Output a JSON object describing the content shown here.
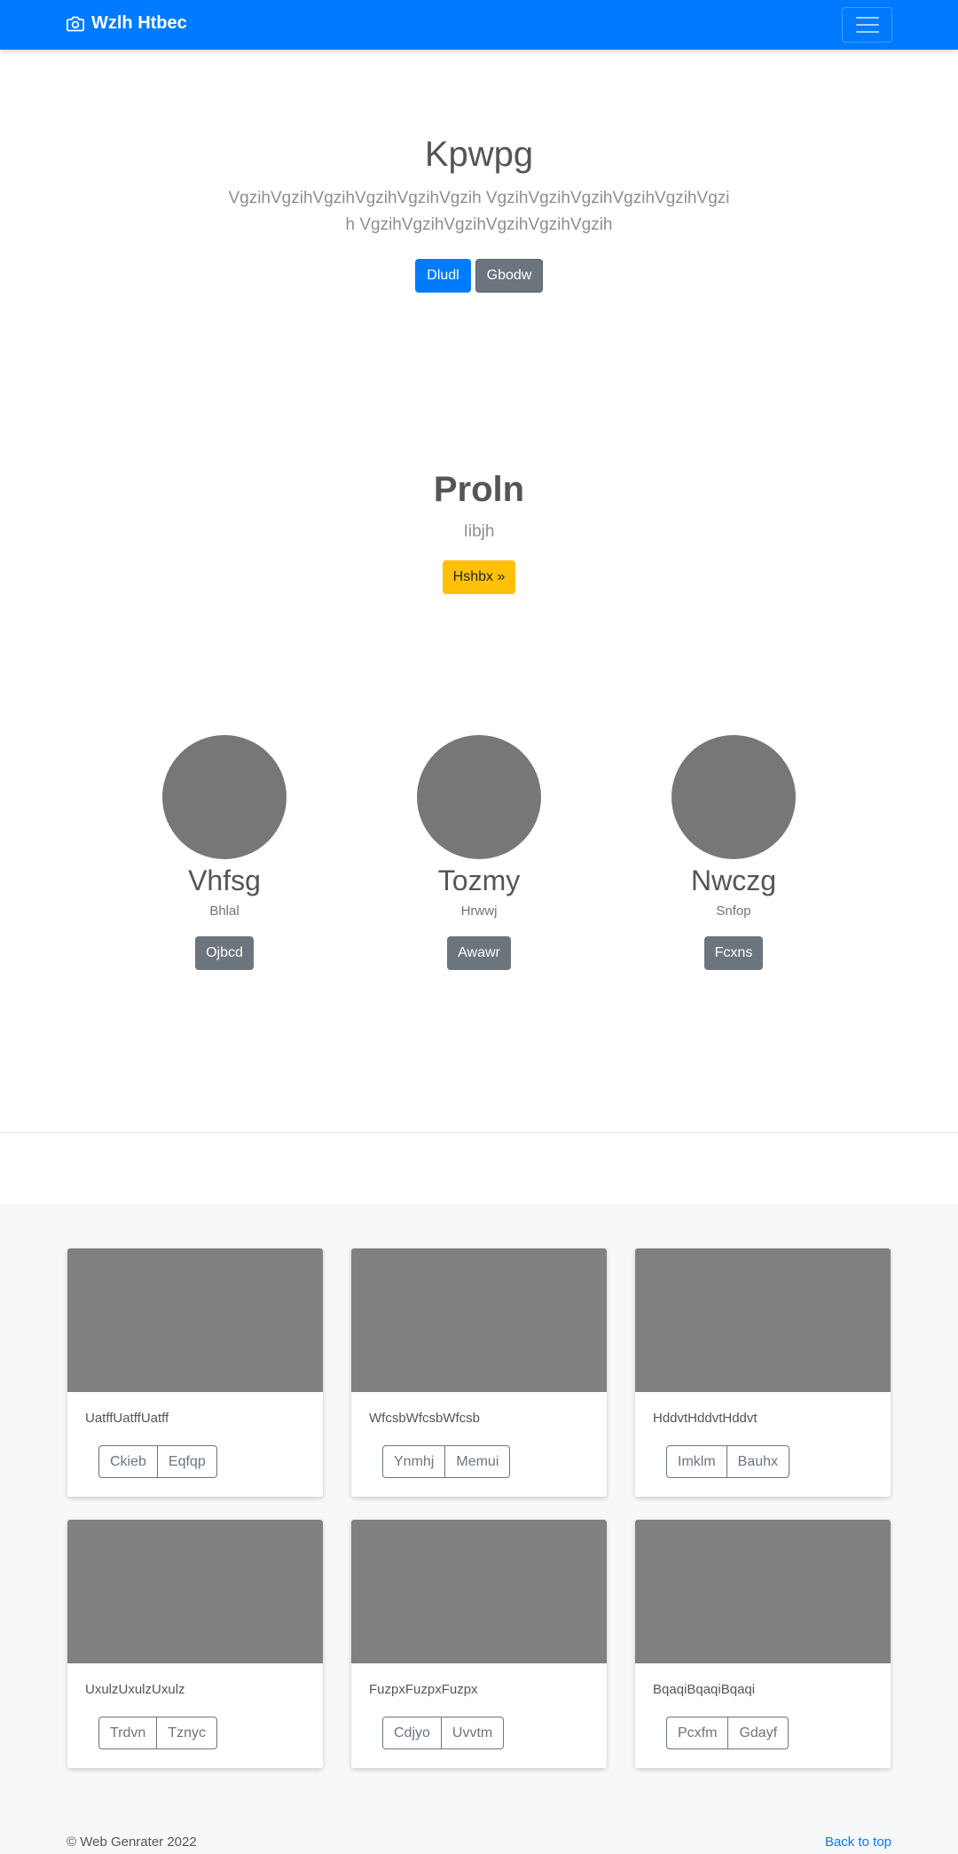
{
  "navbar": {
    "brand": "Wzlh Htbec",
    "brand_icon": "camera-icon",
    "toggler_icon": "hamburger-icon",
    "color": "#007bff"
  },
  "hero": {
    "title": "Kpwpg",
    "lead": "VgzihVgzihVgzihVgzihVgzihVgzih VgzihVgzihVgzihVgzihVgzihVgzih VgzihVgzihVgzihVgzihVgzihVgzih",
    "primary_button": "Dludl",
    "secondary_button": "Gbodw"
  },
  "section2": {
    "title": "Proln",
    "subtitle": "Iibjh",
    "button": "Hshbx »",
    "button_color": "#ffc107"
  },
  "people": [
    {
      "name": "Vhfsg",
      "role": "Bhlal",
      "button": "Ojbcd"
    },
    {
      "name": "Tozmy",
      "role": "Hrwwj",
      "button": "Awawr"
    },
    {
      "name": "Nwczg",
      "role": "Snfop",
      "button": "Fcxns"
    }
  ],
  "cards": [
    {
      "text": "UatffUatffUatff",
      "buttons": [
        "Ckieb",
        "Eqfqp"
      ]
    },
    {
      "text": "WfcsbWfcsbWfcsb",
      "buttons": [
        "Ynmhj",
        "Memui"
      ]
    },
    {
      "text": "HddvtHddvtHddvt",
      "buttons": [
        "Imklm",
        "Bauhx"
      ]
    },
    {
      "text": "UxulzUxulzUxulz",
      "buttons": [
        "Trdvn",
        "Tznyc"
      ]
    },
    {
      "text": "FuzpxFuzpxFuzpx",
      "buttons": [
        "Cdjyo",
        "Uvvtm"
      ]
    },
    {
      "text": "BqaqiBqaqiBqaqi",
      "buttons": [
        "Pcxfm",
        "Gdayf"
      ]
    }
  ],
  "footer": {
    "copyright": "© Web Genrater 2022",
    "back_to_top": "Back to top"
  }
}
